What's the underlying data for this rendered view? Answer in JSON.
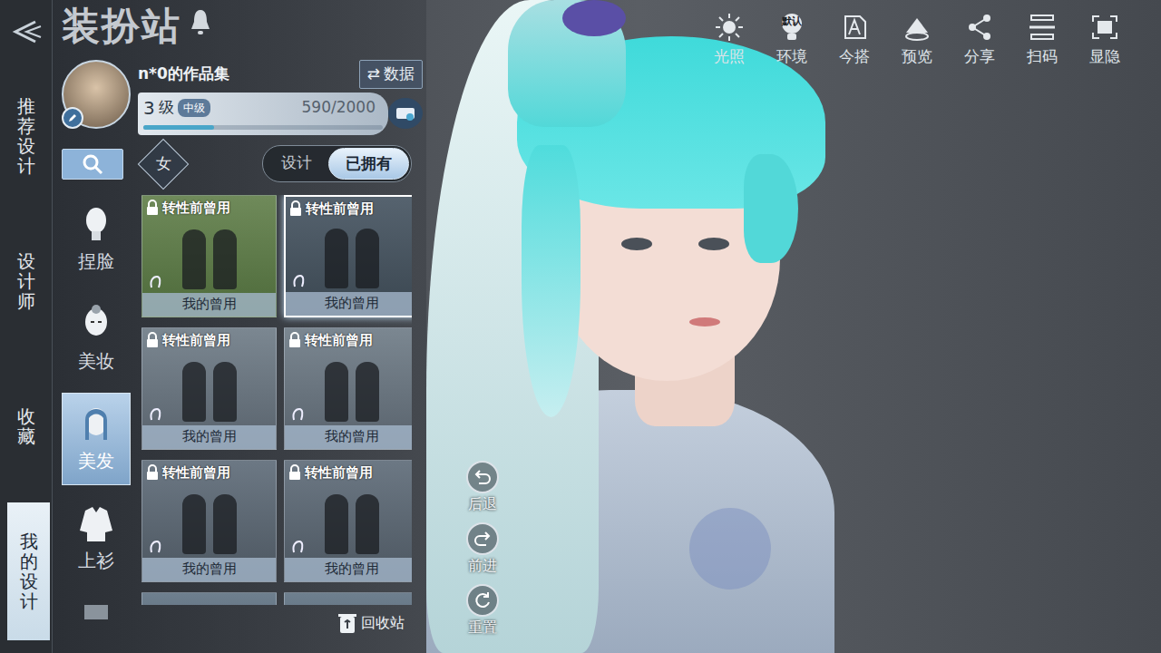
{
  "nav": {
    "items": [
      {
        "label": "推荐设计",
        "selected": false
      },
      {
        "label": "设计师",
        "selected": false
      },
      {
        "label": "收藏",
        "selected": false
      },
      {
        "label": "我的设计",
        "selected": true
      }
    ]
  },
  "header": {
    "title": "装扮站"
  },
  "profile": {
    "name": "n*0的作品集",
    "data_button": {
      "icon": "⇄",
      "label": "数据"
    },
    "level": "3",
    "level_unit": "级",
    "rank": "中级",
    "exp": "590/2000",
    "exp_level": 0.295
  },
  "filters": {
    "gender": "女",
    "toggle": [
      {
        "label": "设计",
        "selected": false
      },
      {
        "label": "已拥有",
        "selected": true
      }
    ]
  },
  "categories": [
    {
      "label": "捏脸",
      "selected": false
    },
    {
      "label": "美妆",
      "selected": false
    },
    {
      "label": "美发",
      "selected": true
    },
    {
      "label": "上衫",
      "selected": false
    }
  ],
  "cards": [
    {
      "kind": "full",
      "badge": "转性前曾用",
      "caption": "我的曾用",
      "selected": false
    },
    {
      "kind": "full",
      "badge": "转性前曾用",
      "caption": "我的曾用",
      "selected": true
    },
    {
      "kind": "full",
      "badge": "转性前曾用",
      "caption": "我的曾用",
      "selected": false
    },
    {
      "kind": "full",
      "badge": "转性前曾用",
      "caption": "我的曾用",
      "selected": false
    },
    {
      "kind": "full",
      "badge": "转性前曾用",
      "caption": "我的曾用",
      "selected": false
    },
    {
      "kind": "full",
      "badge": "转性前曾用",
      "caption": "我的曾用",
      "selected": false
    },
    {
      "kind": "peek",
      "selected": false
    },
    {
      "kind": "peek",
      "selected": false
    }
  ],
  "recycle": {
    "label": "回收站"
  },
  "toolbar": [
    {
      "label": "光照"
    },
    {
      "label": "环境",
      "icon_text": "默认"
    },
    {
      "label": "今搭"
    },
    {
      "label": "预览"
    },
    {
      "label": "分享"
    },
    {
      "label": "扫码"
    },
    {
      "label": "显隐"
    }
  ],
  "history": [
    {
      "label": "后退"
    },
    {
      "label": "前进"
    },
    {
      "label": "重置"
    }
  ]
}
